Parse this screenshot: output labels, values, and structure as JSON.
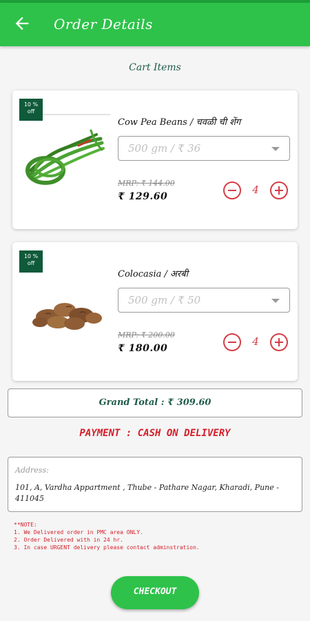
{
  "app": {
    "title": "Order Details"
  },
  "section_title": "Cart Items",
  "cart": [
    {
      "discount": "10 %",
      "discount_suffix": "off",
      "name": "Cow Pea Beans / चवळी ची शेंग",
      "variant": "500 gm / ₹ 36",
      "mrp": "MRP: ₹ 144.00",
      "price": "₹ 129.60",
      "quantity": "4",
      "image_icon": "cow-pea-beans-image"
    },
    {
      "discount": "10 %",
      "discount_suffix": "off",
      "name": "Colocasia / अरबी",
      "variant": "500 gm / ₹ 50",
      "mrp": "MRP: ₹ 200.00",
      "price": "₹ 180.00",
      "quantity": "4",
      "image_icon": "colocasia-image"
    }
  ],
  "grand_total": "Grand Total : ₹ 309.60",
  "payment": "PAYMENT : CASH ON DELIVERY",
  "address": {
    "label": "Address:",
    "value": "101, A, Vardha Appartment , Thube - Pathare Nagar, Kharadi, Pune - 411045"
  },
  "notes": {
    "title": "**NOTE:",
    "lines": [
      "1. We Delivered order in PMC area ONLY.",
      "2. Order Delivered with in 24 hr.",
      "3. In case URGENT delivery please contact adminstration."
    ]
  },
  "checkout_label": "CHECKOUT",
  "colors": {
    "appbar": "#2ec24a",
    "accent_red": "#d41f2a",
    "badge_green": "#0f5a3a",
    "text_teal": "#1f5b4a"
  }
}
